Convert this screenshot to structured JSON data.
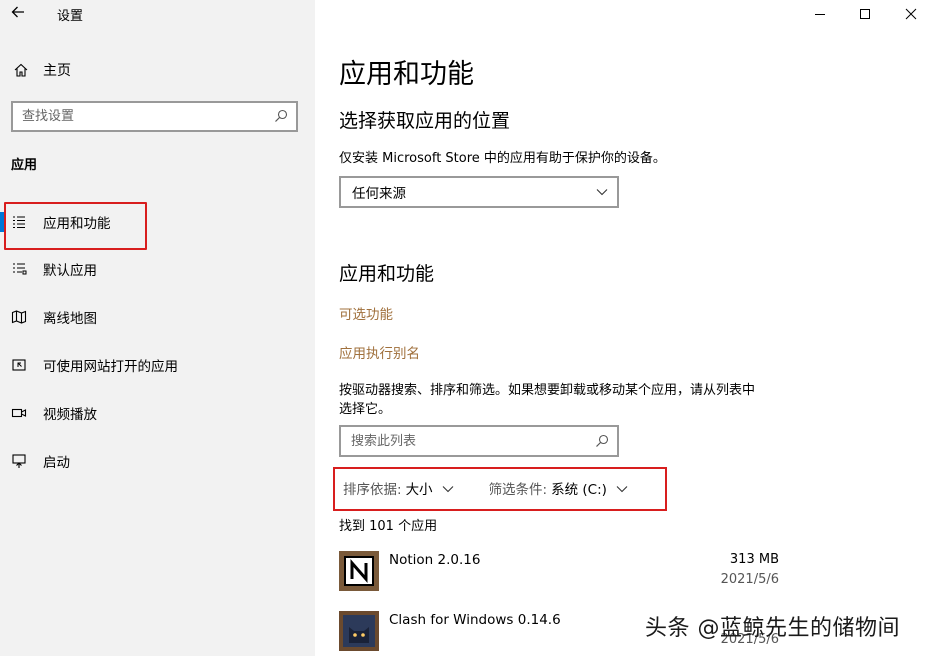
{
  "window": {
    "title": "设置"
  },
  "sidebar": {
    "home_label": "主页",
    "search_placeholder": "查找设置",
    "section_title": "应用",
    "items": [
      {
        "label": "应用和功能",
        "icon": "apps-list-icon",
        "active": true
      },
      {
        "label": "默认应用",
        "icon": "default-apps-icon"
      },
      {
        "label": "离线地图",
        "icon": "map-icon"
      },
      {
        "label": "可使用网站打开的应用",
        "icon": "web-app-icon"
      },
      {
        "label": "视频播放",
        "icon": "video-icon"
      },
      {
        "label": "启动",
        "icon": "startup-icon"
      }
    ]
  },
  "main": {
    "page_title": "应用和功能",
    "install_section": {
      "heading": "选择获取应用的位置",
      "description": "仅安装 Microsoft Store 中的应用有助于保护你的设备。",
      "dropdown_value": "任何来源"
    },
    "apps_section": {
      "heading": "应用和功能",
      "links": [
        "可选功能",
        "应用执行别名"
      ],
      "description_line1": "按驱动器搜索、排序和筛选。如果想要卸载或移动某个应用，请从列表中",
      "description_line2": "选择它。",
      "search_placeholder": "搜索此列表",
      "sort_label": "排序依据:",
      "sort_value": "大小",
      "filter_label": "筛选条件:",
      "filter_value": "系统 (C:)",
      "count_text": "找到 101 个应用"
    },
    "apps": [
      {
        "name": "Notion 2.0.16",
        "size": "313 MB",
        "date": "2021/5/6",
        "icon": "notion-icon"
      },
      {
        "name": "Clash for Windows 0.14.6",
        "size": "",
        "date": "2021/5/6",
        "icon": "clash-cat-icon"
      }
    ]
  },
  "watermark": "头条 @蓝鲸先生的储物间",
  "colors": {
    "sidebar_bg": "#f2f2f2",
    "link": "#a0703c",
    "highlight": "#d81e1e",
    "accent": "#0078d7"
  }
}
